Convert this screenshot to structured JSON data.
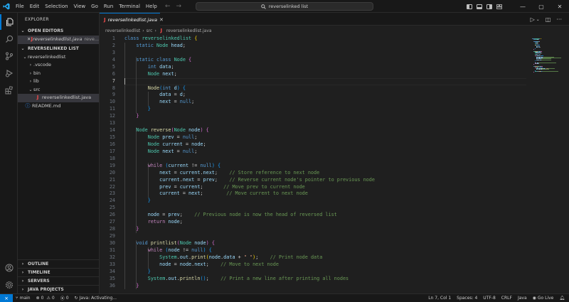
{
  "menu": [
    "File",
    "Edit",
    "Selection",
    "View",
    "Go",
    "Run",
    "Terminal",
    "Help"
  ],
  "search": {
    "text": "reverselinked list"
  },
  "sidebar": {
    "title": "EXPLORER",
    "open_editors_label": "OPEN EDITORS",
    "open_editor_file": "reverselinkedlist.java",
    "open_editor_path": "reve...",
    "workspace_label": "REVERSELINKED LIST",
    "tree": {
      "root": "reverselinkedlist",
      "vscode": ".vscode",
      "bin": "bin",
      "lib": "lib",
      "src": "src",
      "file": "reverselinkedlist.java",
      "readme": "README.md"
    },
    "bottom": [
      "OUTLINE",
      "TIMELINE",
      "SERVERS",
      "JAVA PROJECTS"
    ]
  },
  "tab": {
    "label": "reverselinkedlist.java"
  },
  "breadcrumb": {
    "root": "reverselinkedlist",
    "src": "src",
    "file": "reverselinkedlist.java"
  },
  "editor": {
    "current_line": 7,
    "lines": [
      [
        [
          "kw",
          "class "
        ],
        [
          "cls",
          "reverselinkedlist"
        ],
        [
          "pl",
          " "
        ],
        [
          "br1",
          "{"
        ]
      ],
      [
        [
          "pl",
          "    "
        ],
        [
          "kw",
          "static "
        ],
        [
          "cls",
          "Node "
        ],
        [
          "var",
          "head"
        ],
        [
          "pl",
          ";"
        ]
      ],
      [],
      [
        [
          "pl",
          "    "
        ],
        [
          "kw",
          "static class "
        ],
        [
          "cls",
          "Node "
        ],
        [
          "br2",
          "{"
        ]
      ],
      [
        [
          "pl",
          "        "
        ],
        [
          "kw",
          "int "
        ],
        [
          "var",
          "data"
        ],
        [
          "pl",
          ";"
        ]
      ],
      [
        [
          "pl",
          "        "
        ],
        [
          "cls",
          "Node "
        ],
        [
          "var",
          "next"
        ],
        [
          "pl",
          ";"
        ]
      ],
      [],
      [
        [
          "pl",
          "        "
        ],
        [
          "fn",
          "Node"
        ],
        [
          "br3",
          "("
        ],
        [
          "kw",
          "int "
        ],
        [
          "var",
          "d"
        ],
        [
          "br3",
          ")"
        ],
        [
          "pl",
          " "
        ],
        [
          "br3",
          "{"
        ]
      ],
      [
        [
          "pl",
          "            "
        ],
        [
          "var",
          "data"
        ],
        [
          "pl",
          " = "
        ],
        [
          "var",
          "d"
        ],
        [
          "pl",
          ";"
        ]
      ],
      [
        [
          "pl",
          "            "
        ],
        [
          "var",
          "next"
        ],
        [
          "pl",
          " = "
        ],
        [
          "kw",
          "null"
        ],
        [
          "pl",
          ";"
        ]
      ],
      [
        [
          "pl",
          "        "
        ],
        [
          "br3",
          "}"
        ]
      ],
      [
        [
          "pl",
          "    "
        ],
        [
          "br2",
          "}"
        ]
      ],
      [],
      [
        [
          "pl",
          "    "
        ],
        [
          "cls",
          "Node "
        ],
        [
          "fn",
          "reverse"
        ],
        [
          "br2",
          "("
        ],
        [
          "cls",
          "Node "
        ],
        [
          "var",
          "node"
        ],
        [
          "br2",
          ")"
        ],
        [
          "pl",
          " "
        ],
        [
          "br2",
          "{"
        ]
      ],
      [
        [
          "pl",
          "        "
        ],
        [
          "cls",
          "Node "
        ],
        [
          "var",
          "prev"
        ],
        [
          "pl",
          " = "
        ],
        [
          "kw",
          "null"
        ],
        [
          "pl",
          ";"
        ]
      ],
      [
        [
          "pl",
          "        "
        ],
        [
          "cls",
          "Node "
        ],
        [
          "var",
          "current"
        ],
        [
          "pl",
          " = "
        ],
        [
          "var",
          "node"
        ],
        [
          "pl",
          ";"
        ]
      ],
      [
        [
          "pl",
          "        "
        ],
        [
          "cls",
          "Node "
        ],
        [
          "var",
          "next"
        ],
        [
          "pl",
          " = "
        ],
        [
          "kw",
          "null"
        ],
        [
          "pl",
          ";"
        ]
      ],
      [],
      [
        [
          "pl",
          "        "
        ],
        [
          "ctrl",
          "while "
        ],
        [
          "br3",
          "("
        ],
        [
          "var",
          "current"
        ],
        [
          "pl",
          " != "
        ],
        [
          "kw",
          "null"
        ],
        [
          "br3",
          ")"
        ],
        [
          "pl",
          " "
        ],
        [
          "br3",
          "{"
        ]
      ],
      [
        [
          "pl",
          "            "
        ],
        [
          "var",
          "next"
        ],
        [
          "pl",
          " = "
        ],
        [
          "var",
          "current"
        ],
        [
          "pl",
          "."
        ],
        [
          "var",
          "next"
        ],
        [
          "pl",
          ";    "
        ],
        [
          "cmt",
          "// Store reference to next node"
        ]
      ],
      [
        [
          "pl",
          "            "
        ],
        [
          "var",
          "current"
        ],
        [
          "pl",
          "."
        ],
        [
          "var",
          "next"
        ],
        [
          "pl",
          " = "
        ],
        [
          "var",
          "prev"
        ],
        [
          "pl",
          ";    "
        ],
        [
          "cmt",
          "// Reverse current node's pointer to previous node"
        ]
      ],
      [
        [
          "pl",
          "            "
        ],
        [
          "var",
          "prev"
        ],
        [
          "pl",
          " = "
        ],
        [
          "var",
          "current"
        ],
        [
          "pl",
          ";       "
        ],
        [
          "cmt",
          "// Move prev to current node"
        ]
      ],
      [
        [
          "pl",
          "            "
        ],
        [
          "var",
          "current"
        ],
        [
          "pl",
          " = "
        ],
        [
          "var",
          "next"
        ],
        [
          "pl",
          ";        "
        ],
        [
          "cmt",
          "// Move current to next node"
        ]
      ],
      [
        [
          "pl",
          "        "
        ],
        [
          "br3",
          "}"
        ]
      ],
      [],
      [
        [
          "pl",
          "        "
        ],
        [
          "var",
          "node"
        ],
        [
          "pl",
          " = "
        ],
        [
          "var",
          "prev"
        ],
        [
          "pl",
          ";    "
        ],
        [
          "cmt",
          "// Previous node is now the head of reversed list"
        ]
      ],
      [
        [
          "pl",
          "        "
        ],
        [
          "ctrl",
          "return "
        ],
        [
          "var",
          "node"
        ],
        [
          "pl",
          ";"
        ]
      ],
      [
        [
          "pl",
          "    "
        ],
        [
          "br2",
          "}"
        ]
      ],
      [],
      [
        [
          "pl",
          "    "
        ],
        [
          "kw",
          "void "
        ],
        [
          "fn",
          "printlist"
        ],
        [
          "br2",
          "("
        ],
        [
          "cls",
          "Node "
        ],
        [
          "var",
          "node"
        ],
        [
          "br2",
          ")"
        ],
        [
          "pl",
          " "
        ],
        [
          "br2",
          "{"
        ]
      ],
      [
        [
          "pl",
          "        "
        ],
        [
          "ctrl",
          "while "
        ],
        [
          "br3",
          "("
        ],
        [
          "var",
          "node"
        ],
        [
          "pl",
          " != "
        ],
        [
          "kw",
          "null"
        ],
        [
          "br3",
          ")"
        ],
        [
          "pl",
          " "
        ],
        [
          "br3",
          "{"
        ]
      ],
      [
        [
          "pl",
          "            "
        ],
        [
          "cls",
          "System"
        ],
        [
          "pl",
          "."
        ],
        [
          "var",
          "out"
        ],
        [
          "pl",
          "."
        ],
        [
          "fn",
          "print"
        ],
        [
          "br1",
          "("
        ],
        [
          "var",
          "node"
        ],
        [
          "pl",
          "."
        ],
        [
          "var",
          "data"
        ],
        [
          "pl",
          " + "
        ],
        [
          "str",
          "\" \""
        ],
        [
          "br1",
          ")"
        ],
        [
          "pl",
          ";    "
        ],
        [
          "cmt",
          "// Print node data"
        ]
      ],
      [
        [
          "pl",
          "            "
        ],
        [
          "var",
          "node"
        ],
        [
          "pl",
          " = "
        ],
        [
          "var",
          "node"
        ],
        [
          "pl",
          "."
        ],
        [
          "var",
          "next"
        ],
        [
          "pl",
          ";    "
        ],
        [
          "cmt",
          "// Move to next node"
        ]
      ],
      [
        [
          "pl",
          "        "
        ],
        [
          "br3",
          "}"
        ]
      ],
      [
        [
          "pl",
          "        "
        ],
        [
          "cls",
          "System"
        ],
        [
          "pl",
          "."
        ],
        [
          "var",
          "out"
        ],
        [
          "pl",
          "."
        ],
        [
          "fn",
          "println"
        ],
        [
          "br3",
          "()"
        ],
        [
          "pl",
          ";    "
        ],
        [
          "cmt",
          "// Print a new line after printing all nodes"
        ]
      ],
      [
        [
          "pl",
          "    "
        ],
        [
          "br2",
          "}"
        ]
      ]
    ]
  },
  "status": {
    "branch": "main",
    "errors": "0",
    "warnings": "0",
    "info": "0",
    "java": "Java: Activating...",
    "position": "Ln 7, Col 1",
    "spaces": "Spaces: 4",
    "encoding": "UTF-8",
    "eol": "CRLF",
    "language": "Java",
    "golive": "Go Live"
  },
  "colors": {
    "accent": "#0078d4",
    "background": "#1f1f1f",
    "sidebar": "#181818"
  }
}
